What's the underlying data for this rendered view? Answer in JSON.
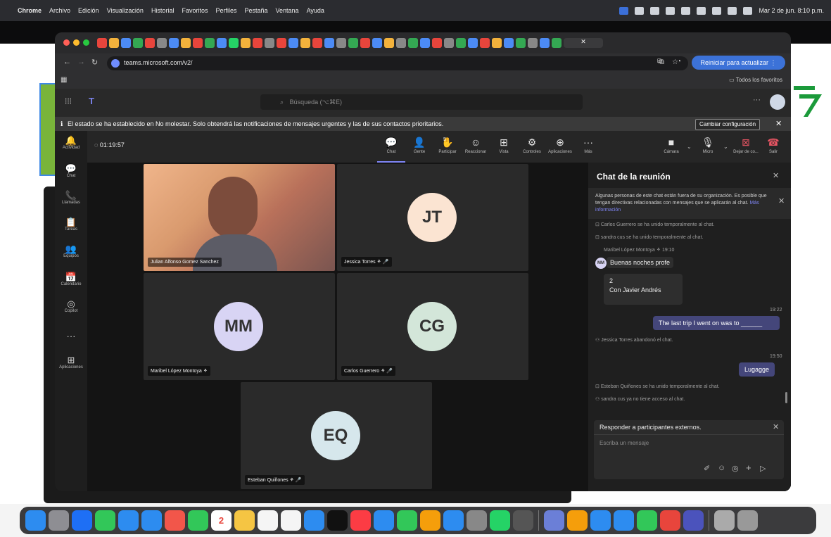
{
  "menubar": {
    "apple": "",
    "items": [
      "Chrome",
      "Archivo",
      "Edición",
      "Visualización",
      "Historial",
      "Favoritos",
      "Perfiles",
      "Pestaña",
      "Ventana",
      "Ayuda"
    ],
    "clock": "Mar 2 de jun. 8:10 p.m."
  },
  "browser": {
    "url": "teams.microsoft.com/v2/",
    "update_label": "Reiniciar para actualizar",
    "bookmarks_label": "Todos los favoritos"
  },
  "teams": {
    "search_placeholder": "Búsqueda (⌥⌘E)",
    "dnd_text": "El estado se ha establecido en No molestar. Solo obtendrá las notificaciones de mensajes urgentes y las de sus contactos prioritarios.",
    "dnd_button": "Cambiar configuración",
    "sidebar": [
      {
        "label": "Actividad",
        "icon": "bell-icon",
        "glyph": "🔔"
      },
      {
        "label": "Chat",
        "icon": "chat-icon",
        "glyph": "💬"
      },
      {
        "label": "Llamadas",
        "icon": "phone-icon",
        "glyph": "📞"
      },
      {
        "label": "Tareas",
        "icon": "tasks-icon",
        "glyph": "📋"
      },
      {
        "label": "Equipos",
        "icon": "teams-icon",
        "glyph": "👥"
      },
      {
        "label": "Calendario",
        "icon": "calendar-icon",
        "glyph": "📅"
      },
      {
        "label": "Copilot",
        "icon": "copilot-icon",
        "glyph": "◎"
      },
      {
        "label": "",
        "icon": "more-icon",
        "glyph": "···"
      },
      {
        "label": "Aplicaciones",
        "icon": "apps-icon",
        "glyph": "⊞"
      }
    ],
    "meeting": {
      "timer": "01:19:57",
      "tools": [
        {
          "label": "Chat",
          "glyph": "💬"
        },
        {
          "label": "Gente",
          "glyph": "👤"
        },
        {
          "label": "Participar",
          "glyph": "✋"
        },
        {
          "label": "Reaccionar",
          "glyph": "☺"
        },
        {
          "label": "Vista",
          "glyph": "⊞"
        },
        {
          "label": "Controles",
          "glyph": "⚙"
        },
        {
          "label": "Aplicaciones",
          "glyph": "⊕"
        },
        {
          "label": "Más",
          "glyph": "···"
        }
      ],
      "people_count": "5",
      "camera_label": "Cámara",
      "mic_label": "Micro",
      "share_label": "Dejar de co...",
      "leave_label": "Salir"
    },
    "participants": [
      {
        "name": "Julian Alfonso Gomez Sanchez",
        "initials": ""
      },
      {
        "name": "Jessica Torres",
        "initials": "JT"
      },
      {
        "name": "Maribel López Montoya",
        "initials": "MM"
      },
      {
        "name": "Carlos Guerrero",
        "initials": "CG"
      },
      {
        "name": "Esteban Quiñones",
        "initials": "EQ"
      }
    ],
    "chat": {
      "title": "Chat de la reunión",
      "external_notice": "Algunas personas de este chat están fuera de su organización. Es posible que tengan directivas relacionadas con mensajes que se aplicarán al chat.",
      "more_info": "Más información",
      "sys1": "Carlos Guerrero se ha unido temporalmente al chat.",
      "sys2": "sandra cus se ha unido temporalmente al chat.",
      "sender": "Maribel López Montoya",
      "sender_time": "19:10",
      "sender_initials": "MM",
      "msg1": "Buenas noches profe",
      "msg2a": "2",
      "msg2b": "Con Javier Andrés",
      "time2": "19:22",
      "msg3": "The last trip I went on was to ______",
      "sys3": "Jessica Torres abandonó el chat.",
      "time3": "19:50",
      "msg4": "Lugagge",
      "sys4": "Esteban Quiñones se ha unido temporalmente al chat.",
      "sys5": "sandra cus ya no tiene acceso al chat.",
      "reply_label": "Responder a participantes externos.",
      "input_placeholder": "Escriba un mensaje"
    }
  },
  "dock": {
    "calendar_day": "2"
  },
  "colors": {
    "accent": "#4f52b2",
    "mm_avatar": "#d8d4f4",
    "jt_avatar": "#fbe4d2",
    "cg_avatar": "#d3e6d9",
    "eq_avatar": "#d6e7ec",
    "leave_red": "#c4314b"
  }
}
